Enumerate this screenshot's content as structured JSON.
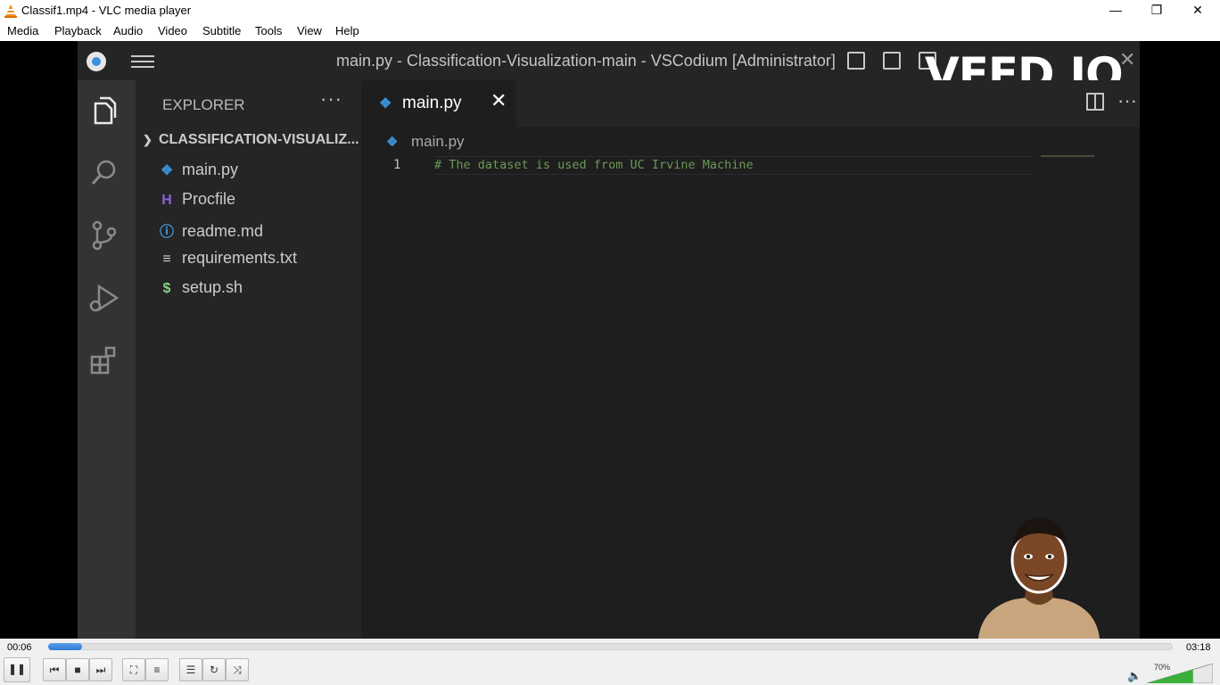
{
  "window": {
    "title": "Classif1.mp4 - VLC media player",
    "controls": {
      "minimize": "—",
      "restore": "❐",
      "close": "✕"
    }
  },
  "menu": [
    "Media",
    "Playback",
    "Audio",
    "Video",
    "Subtitle",
    "Tools",
    "View",
    "Help"
  ],
  "video": {
    "watermark": "VEED.IO",
    "vscode": {
      "title": "main.py - Classification-Visualization-main - VSCodium [Administrator]",
      "explorer": {
        "title": "EXPLORER",
        "more": "···",
        "folder": "CLASSIFICATION-VISUALIZ...",
        "files": [
          {
            "name": "main.py",
            "icon": "python-icon",
            "glyph": "❖",
            "color": "#3b8ed0"
          },
          {
            "name": "Procfile",
            "icon": "heroku-icon",
            "glyph": "H",
            "color": "#8a63d2"
          },
          {
            "name": "readme.md",
            "icon": "info-icon",
            "glyph": "ⓘ",
            "color": "#4a9fe0"
          },
          {
            "name": "requirements.txt",
            "icon": "lines-icon",
            "glyph": "≡",
            "color": "#cccccc"
          },
          {
            "name": "setup.sh",
            "icon": "dollar-icon",
            "glyph": "$",
            "color": "#89d185"
          }
        ]
      },
      "tab": {
        "label": "main.py",
        "close": "✕"
      },
      "editor_more": "···",
      "breadcrumb": "main.py",
      "code": [
        {
          "line": "1",
          "text": "# The dataset is used from UC Irvine Machine"
        }
      ]
    }
  },
  "player": {
    "time_elapsed": "00:06",
    "time_total": "03:18",
    "progress": 0.03,
    "volume_label": "70%",
    "volume": 0.7,
    "buttons": {
      "pause": "❚❚",
      "previous": "⏮",
      "stop": "■",
      "next": "⏭",
      "fullscreen": "⛶",
      "extended": "≡",
      "playlist": "☰",
      "loop": "↻",
      "shuffle": "⤨"
    }
  },
  "colors": {
    "accent": "#2f7ad6",
    "comment": "#6a9955",
    "volume": "#3ab03a"
  }
}
